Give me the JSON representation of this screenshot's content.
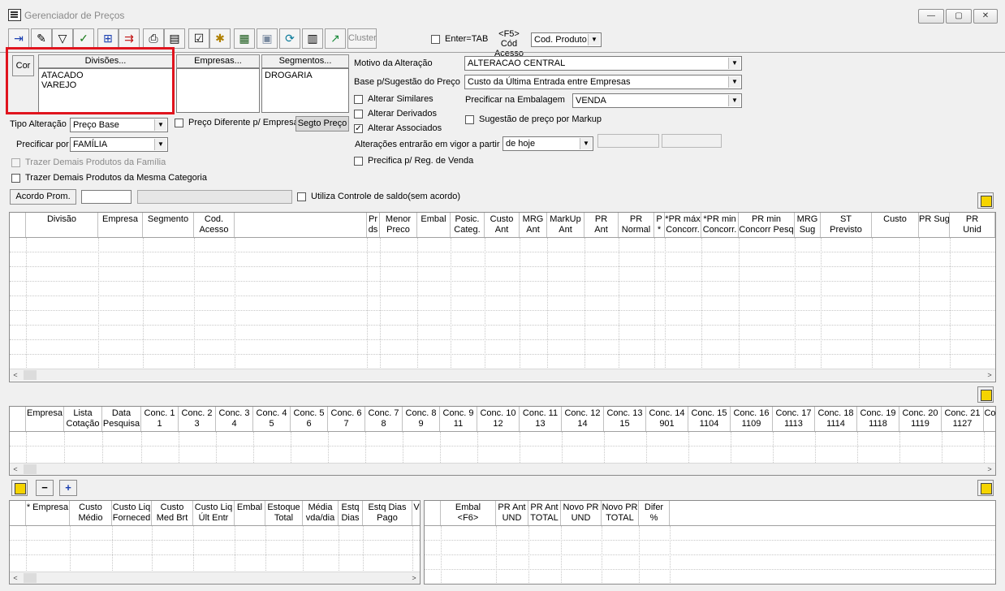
{
  "window": {
    "title": "Gerenciador de Preços"
  },
  "toolbar": {
    "cluster_label": "Cluster",
    "enter_tab_label": "Enter=TAB",
    "f5_label": "<F5> Cód Acesso",
    "cod_combo": "Cod. Produto"
  },
  "filters": {
    "cor_label": "Cor",
    "divisoes_label": "Divisões...",
    "empresas_label": "Empresas...",
    "segmentos_label": "Segmentos...",
    "divisoes_items": [
      "ATACADO",
      "VAREJO"
    ],
    "segmentos_items": [
      "DROGARIA"
    ],
    "tipo_alteracao_label": "Tipo Alteração",
    "tipo_alteracao_value": "Preço Base",
    "preco_diferente_label": "Preço Diferente p/ Empresa",
    "segto_preco_label": "Segto Preço",
    "precificar_por_label": "Precificar por",
    "precificar_por_value": "FAMÍLIA",
    "trazer_familia_label": "Trazer Demais Produtos da Família",
    "trazer_categoria_label": "Trazer Demais Produtos da Mesma Categoria",
    "acordo_label": "Acordo Prom.",
    "controle_saldo_label": "Utiliza Controle de saldo(sem acordo)"
  },
  "options": {
    "motivo_label": "Motivo da Alteração",
    "motivo_value": "ALTERACAO CENTRAL",
    "base_label": "Base p/Sugestão do Preço",
    "base_value": "Custo da Última Entrada entre Empresas",
    "alterar_similares": "Alterar Similares",
    "alterar_derivados": "Alterar Derivados",
    "alterar_associados": "Alterar Associados",
    "precificar_embalagem_label": "Precificar na Embalagem",
    "precificar_embalagem_value": "VENDA",
    "sugestao_markup": "Sugestão de preço por Markup",
    "vigor_label": "Alterações entrarão em vigor a partir",
    "vigor_value": "de hoje",
    "precifica_reg_venda": "Precifica p/ Reg. de Venda"
  },
  "grid1": {
    "headers": [
      "Divisão",
      "Empresa",
      "Segmento",
      "Cod.\nAcesso",
      "",
      "Pr\nds",
      "Menor\nPreco",
      "Embal",
      "Posic.\nCateg.",
      "Custo\nAnt",
      "MRG\nAnt",
      "MarkUp\nAnt",
      "PR\nAnt",
      "PR\nNormal",
      "P\n*",
      "*PR máx\nConcorr.",
      "*PR min\nConcorr.",
      "PR min\nConcorr Pesq",
      "MRG\nSug",
      "ST\nPrevisto",
      "Custo",
      "PR Sug",
      "PR\nUnid"
    ]
  },
  "grid2": {
    "headers": [
      "Empresa",
      "Lista\nCotação",
      "Data\nPesquisa",
      "Conc. 1\n1",
      "Conc. 2\n3",
      "Conc. 3\n4",
      "Conc. 4\n5",
      "Conc. 5\n6",
      "Conc. 6\n7",
      "Conc. 7\n8",
      "Conc. 8\n9",
      "Conc. 9\n11",
      "Conc. 10\n12",
      "Conc. 11\n13",
      "Conc. 12\n14",
      "Conc. 13\n15",
      "Conc. 14\n901",
      "Conc. 15\n1104",
      "Conc. 16\n1109",
      "Conc. 17\n1113",
      "Conc. 18\n1114",
      "Conc. 19\n1118",
      "Conc. 20\n1119",
      "Conc. 21\n1127",
      "Co"
    ]
  },
  "grid3": {
    "headers": [
      "* Empresa",
      "Custo\nMédio",
      "Custo Liq\nForneced",
      "Custo\nMed Brt",
      "Custo Liq\nÚlt Entr",
      "Embal",
      "Estoque\nTotal",
      "Média\nvda/dia",
      "Estq\nDias",
      "Estq Dias\nPago",
      "V"
    ]
  },
  "grid4": {
    "headers": [
      "Embal\n<F6>",
      "PR Ant\nUND",
      "PR Ant\nTOTAL",
      "Novo PR\nUND",
      "Novo PR\nTOTAL",
      "Difer\n%"
    ]
  },
  "mini": {
    "minus": "−",
    "plus": "+"
  }
}
